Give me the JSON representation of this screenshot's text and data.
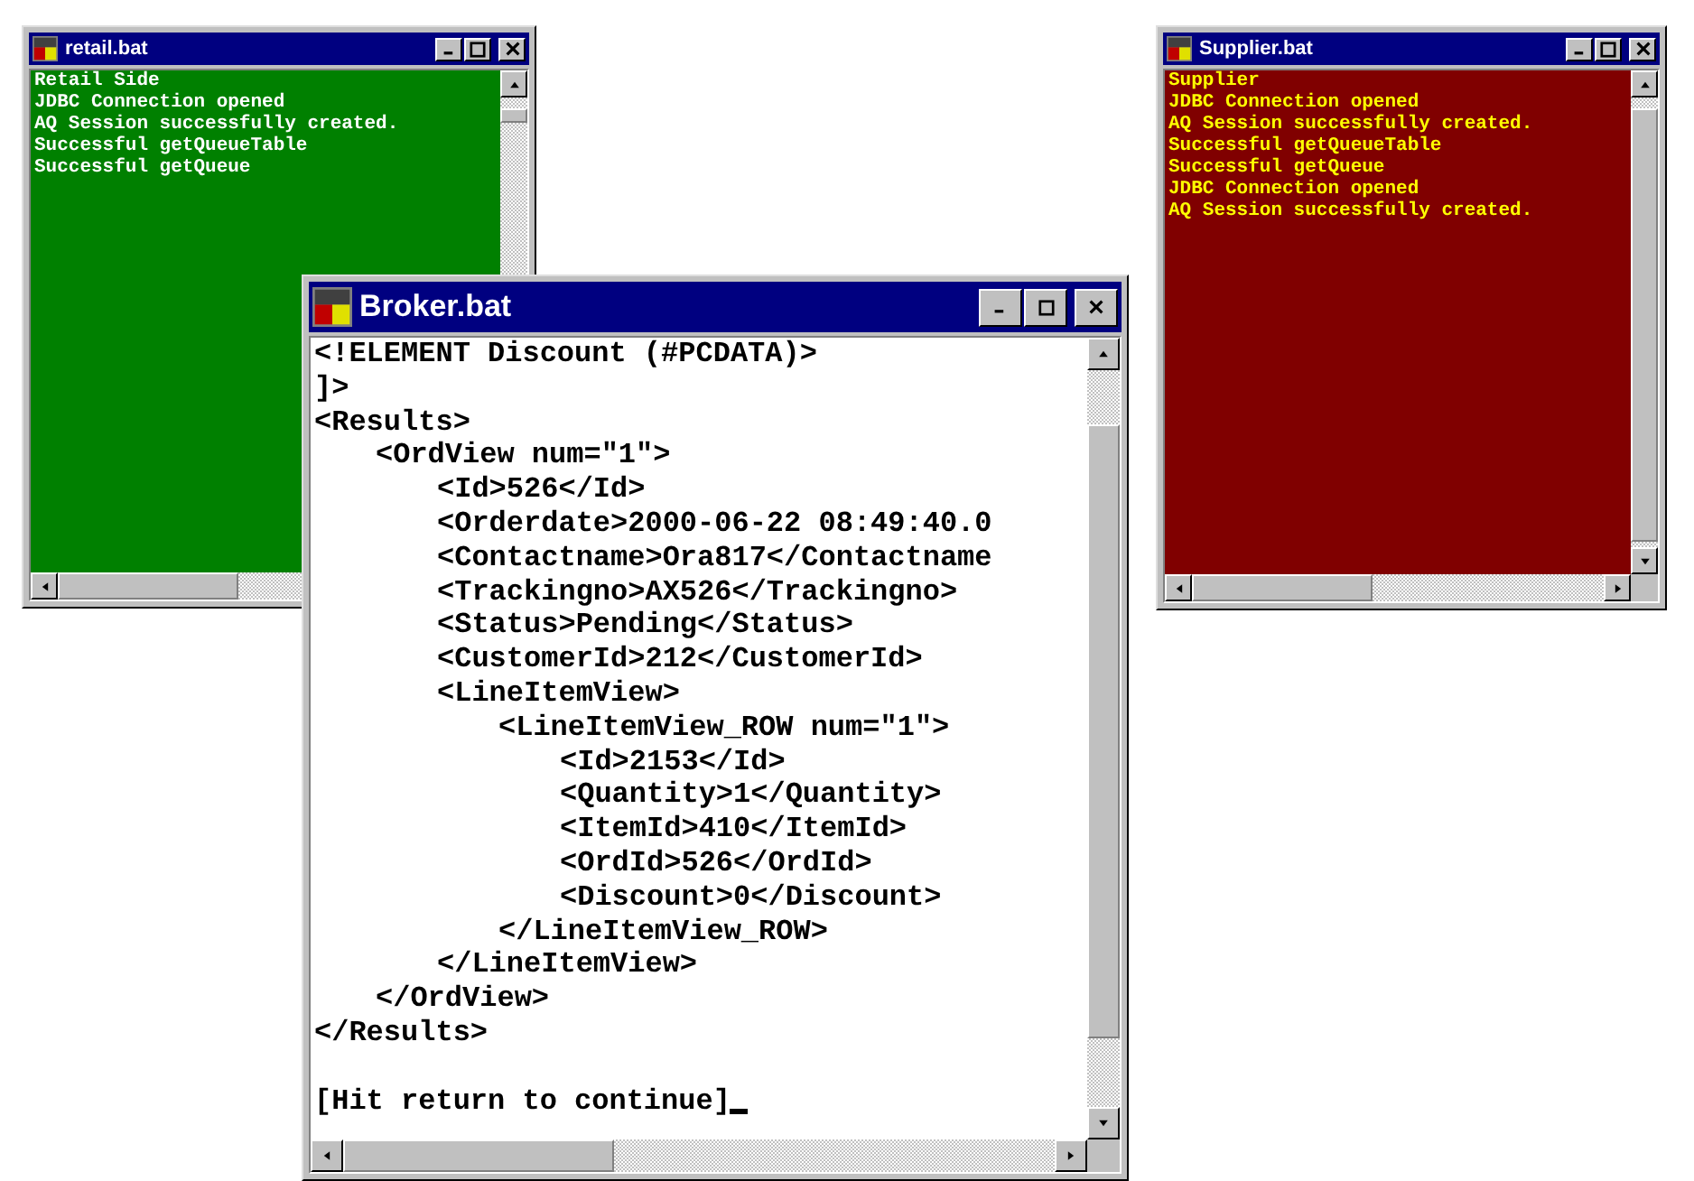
{
  "windows": [
    {
      "title": "retail.bat",
      "kind": "small",
      "color": "#008000",
      "lines": [
        {
          "text": "Retail Side"
        },
        {
          "text": "JDBC Connection opened"
        },
        {
          "text": "AQ Session successfully created."
        },
        {
          "text": "Successful getQueueTable"
        },
        {
          "text": "Successful getQueue"
        }
      ]
    },
    {
      "title": "Supplier.bat",
      "kind": "small",
      "color": "#800000",
      "lines": [
        {
          "text": "Supplier"
        },
        {
          "text": "JDBC Connection opened"
        },
        {
          "text": "AQ Session successfully created."
        },
        {
          "text": "Successful getQueueTable"
        },
        {
          "text": "Successful getQueue"
        },
        {
          "text": "JDBC Connection opened"
        },
        {
          "text": "AQ Session successfully created."
        }
      ]
    },
    {
      "title": "Broker.bat",
      "kind": "large",
      "color": "#ffffff",
      "lines": [
        {
          "text": "<!ELEMENT Discount (#PCDATA)>"
        },
        {
          "text": "]>"
        },
        {
          "text": "<Results>",
          "children": [
            {
              "text": "<OrdView num=\"1\">",
              "children": [
                {
                  "text": "<Id>526</Id>"
                },
                {
                  "text": "<Orderdate>2000-06-22 08:49:40.0"
                },
                {
                  "text": "<Contactname>Ora817</Contactname"
                },
                {
                  "text": "<Trackingno>AX526</Trackingno>"
                },
                {
                  "text": "<Status>Pending</Status>"
                },
                {
                  "text": "<CustomerId>212</CustomerId>"
                },
                {
                  "text": "<LineItemView>",
                  "children": [
                    {
                      "text": "<LineItemView_ROW num=\"1\">",
                      "children": [
                        {
                          "text": "<Id>2153</Id>"
                        },
                        {
                          "text": "<Quantity>1</Quantity>"
                        },
                        {
                          "text": "<ItemId>410</ItemId>"
                        },
                        {
                          "text": "<OrdId>526</OrdId>"
                        },
                        {
                          "text": "<Discount>0</Discount>"
                        }
                      ]
                    },
                    {
                      "text": "</LineItemView_ROW>"
                    }
                  ]
                },
                {
                  "text": "</LineItemView>"
                }
              ]
            },
            {
              "text": "</OrdView>"
            }
          ]
        },
        {
          "text": "</Results>"
        }
      ],
      "prompt": "[Hit return to continue]"
    }
  ]
}
